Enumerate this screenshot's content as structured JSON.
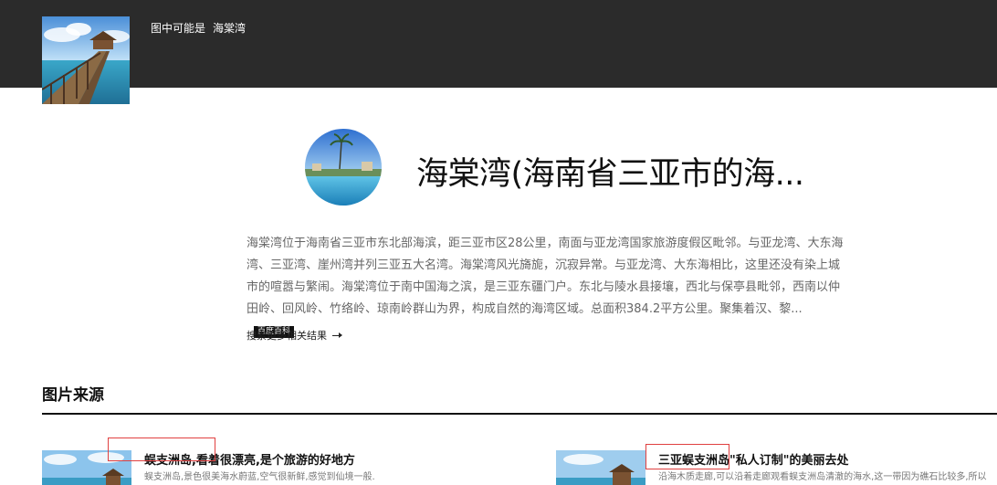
{
  "header": {
    "label": "图中可能是",
    "query": "海棠湾",
    "thumbnail_icon": "pier-photo-icon"
  },
  "entity": {
    "logo_icon": "bay-photo-icon",
    "title": "海棠湾(海南省三亚市的海...",
    "description": "海棠湾位于海南省三亚市东北部海滨，距三亚市区28公里，南面与亚龙湾国家旅游度假区毗邻。与亚龙湾、大东海湾、三亚湾、崖州湾并列三亚五大名湾。海棠湾风光旖旎，沉寂异常。与亚龙湾、大东海相比，这里还没有染上城市的喧嚣与繁闹。海棠湾位于南中国海之滨，是三亚东疆门户。东北与陵水县接壤，西北与保亭县毗邻，西南以仲田岭、回风岭、竹络岭、琼南岭群山为界，构成自然的海湾区域。总面积384.2平方公里。聚集着汉、黎...",
    "badge": "百度百科",
    "more_link": "搜索更多相关结果"
  },
  "sources": {
    "title": "图片来源",
    "items": [
      {
        "title": "蜈支洲岛,看着很漂亮,是个旅游的好地方",
        "description": "蜈支洲岛,景色很美海水蔚蓝,空气很新鲜,感觉到仙境一般."
      },
      {
        "title": "三亚蜈支洲岛\"私人订制\"的美丽去处",
        "description": "沿海木质走廊,可以沿着走廊观看蜈支洲岛清澈的海水,这一带因为礁石比较多,所以"
      }
    ]
  },
  "colors": {
    "topbar": "#2b2b2b",
    "highlight": "#e04040",
    "badge_bg": "#111111"
  }
}
